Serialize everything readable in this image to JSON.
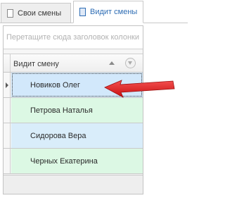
{
  "tabs": [
    {
      "label": "Свои смены",
      "active": false
    },
    {
      "label": "Видит смены",
      "active": true
    }
  ],
  "grid": {
    "group_panel_text": "Перетащите сюда заголовок колонки",
    "column_header": "Видит смену",
    "rows": [
      {
        "name": "Новиков Олег",
        "selected": true
      },
      {
        "name": "Петрова Наталья",
        "selected": false
      },
      {
        "name": "Сидорова Вера",
        "selected": false
      },
      {
        "name": "Черных Екатерина",
        "selected": false
      }
    ]
  },
  "colors": {
    "accent": "#2e6db4",
    "row_blue": "#d9edfa",
    "row_green": "#dcf8e4",
    "pointer_arrow": "#e32222"
  }
}
